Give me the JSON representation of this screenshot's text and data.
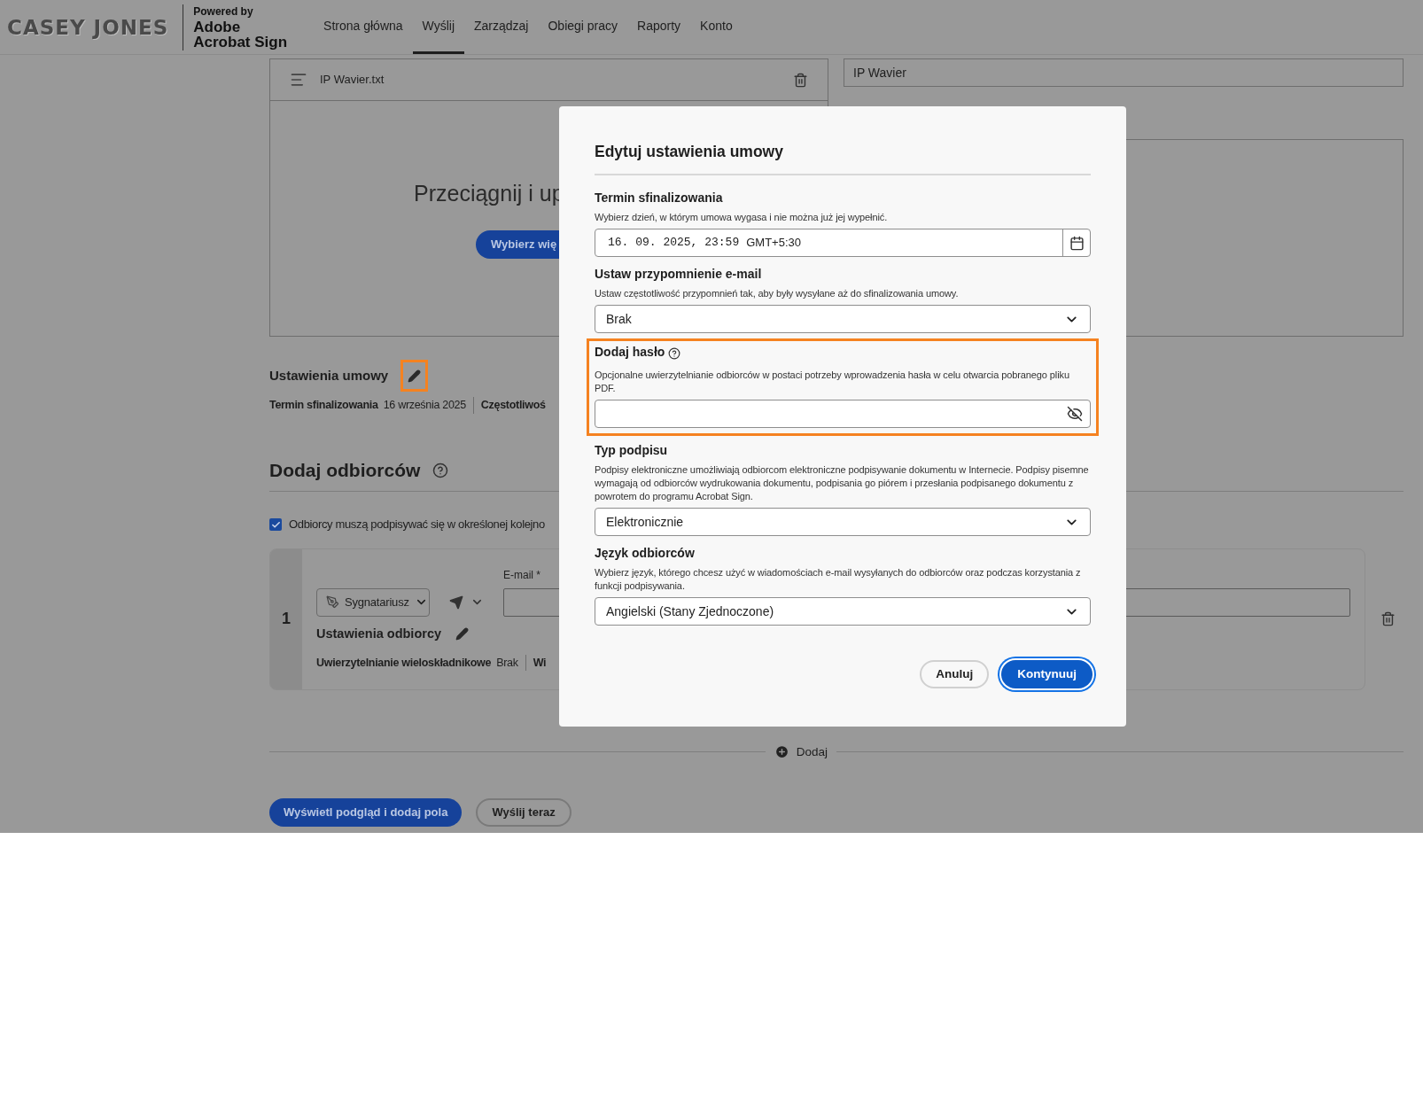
{
  "header": {
    "logo": "CASEY JONES",
    "powered_by": "Powered by",
    "product": [
      "Adobe",
      "Acrobat Sign"
    ],
    "nav": [
      {
        "label": "Strona główna",
        "selected": false
      },
      {
        "label": "Wyślij",
        "selected": true
      },
      {
        "label": "Zarządzaj",
        "selected": false
      },
      {
        "label": "Obiegi pracy",
        "selected": false
      },
      {
        "label": "Raporty",
        "selected": false
      },
      {
        "label": "Konto",
        "selected": false
      }
    ]
  },
  "file_card": {
    "file_name": "IP Wavier.txt",
    "drop_text": "Przeciągnij i up",
    "browse_button": "Wybierz wię"
  },
  "agreement_name": "IP Wavier",
  "agreement_settings": {
    "title": "Ustawienia umowy",
    "highlighted": true,
    "summary": [
      {
        "label": "Termin sfinalizowania",
        "value": "16 września 2025"
      },
      {
        "label": "Częstotliwoś"
      }
    ]
  },
  "recipients": {
    "title": "Dodaj odbiorców",
    "order_checkbox": {
      "label": "Odbiorcy muszą podpisywać się w określonej kolejno",
      "checked": true
    },
    "items": [
      {
        "number": "1",
        "role": "Sygnatariusz",
        "email_label": "E-mail *",
        "settings_title": "Ustawienia odbiorcy",
        "summary": [
          {
            "label": "Uwierzytelnianie wieloskładnikowe",
            "value": "Brak"
          },
          {
            "label": "Wi"
          }
        ]
      }
    ],
    "add_label": "Dodaj"
  },
  "actions": [
    {
      "label": "Wyświetl podgląd i dodaj pola",
      "kind": "primary"
    },
    {
      "label": "Wyślij teraz",
      "kind": "secondary"
    }
  ],
  "dialog": {
    "title": "Edytuj ustawienia umowy",
    "sections": [
      {
        "kind": "date",
        "title": "Termin sfinalizowania",
        "hint": "Wybierz dzień, w którym umowa wygasa i nie można już jej wypełnić.",
        "value": "16. 09. 2025, 23:59",
        "suffix": "GMT+5:30"
      },
      {
        "kind": "select",
        "title": "Ustaw przypomnienie e-mail",
        "hint": "Ustaw częstotliwość przypomnień tak, aby były wysyłane aż do sfinalizowania umowy.",
        "value": "Brak"
      },
      {
        "kind": "password",
        "title": "Dodaj hasło",
        "hint": "Opcjonalne uwierzytelnianie odbiorców w postaci potrzeby wprowadzenia hasła w celu otwarcia pobranego pliku PDF.",
        "highlighted": true
      },
      {
        "kind": "select",
        "title": "Typ podpisu",
        "hint": "Podpisy elektroniczne umożliwiają odbiorcom elektroniczne podpisywanie dokumentu w Internecie. Podpisy pisemne wymagają od odbiorców wydrukowania dokumentu, podpisania go piórem i przesłania podpisanego dokumentu z powrotem do programu Acrobat Sign.",
        "value": "Elektronicznie"
      },
      {
        "kind": "select",
        "title": "Język odbiorców",
        "hint": "Wybierz język, którego chcesz użyć w wiadomościach e-mail wysyłanych do odbiorców oraz podczas korzystania z funkcji podpisywania.",
        "value": "Angielski (Stany Zjednoczone)"
      }
    ],
    "buttons": [
      {
        "label": "Anuluj",
        "kind": "secondary"
      },
      {
        "label": "Kontynuuj",
        "kind": "primary"
      }
    ]
  }
}
